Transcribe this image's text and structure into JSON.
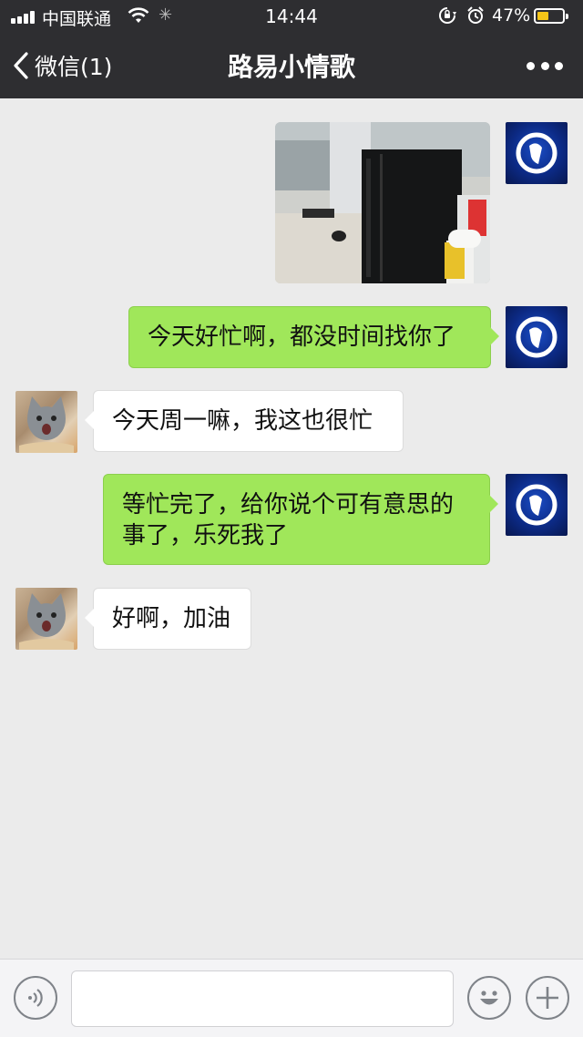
{
  "status_bar": {
    "carrier": "中国联通",
    "time": "14:44",
    "battery_percent": "47%",
    "battery_level": 0.47,
    "battery_color": "#f5c518"
  },
  "nav": {
    "back_label": "微信(1)",
    "title": "路易小情歌",
    "more_icon": "more-dots-icon"
  },
  "messages": [
    {
      "from": "me",
      "type": "image",
      "image_desc_icon": "photo-thumbnail"
    },
    {
      "from": "me",
      "type": "text",
      "text": "今天好忙啊，都没时间找你了"
    },
    {
      "from": "other",
      "type": "text",
      "text": "今天周一嘛，我这也很忙"
    },
    {
      "from": "me",
      "type": "text",
      "text": "等忙完了，给你说个可有意思的事了，乐死我了"
    },
    {
      "from": "other",
      "type": "text",
      "text": "好啊，加油"
    }
  ],
  "input_bar": {
    "voice_icon": "voice-icon",
    "emoji_icon": "emoji-icon",
    "plus_icon": "plus-icon",
    "input_value": ""
  },
  "colors": {
    "header_bg": "#2e2e31",
    "chat_bg": "#ebebeb",
    "my_bubble": "#a0e75a",
    "their_bubble": "#ffffff"
  }
}
